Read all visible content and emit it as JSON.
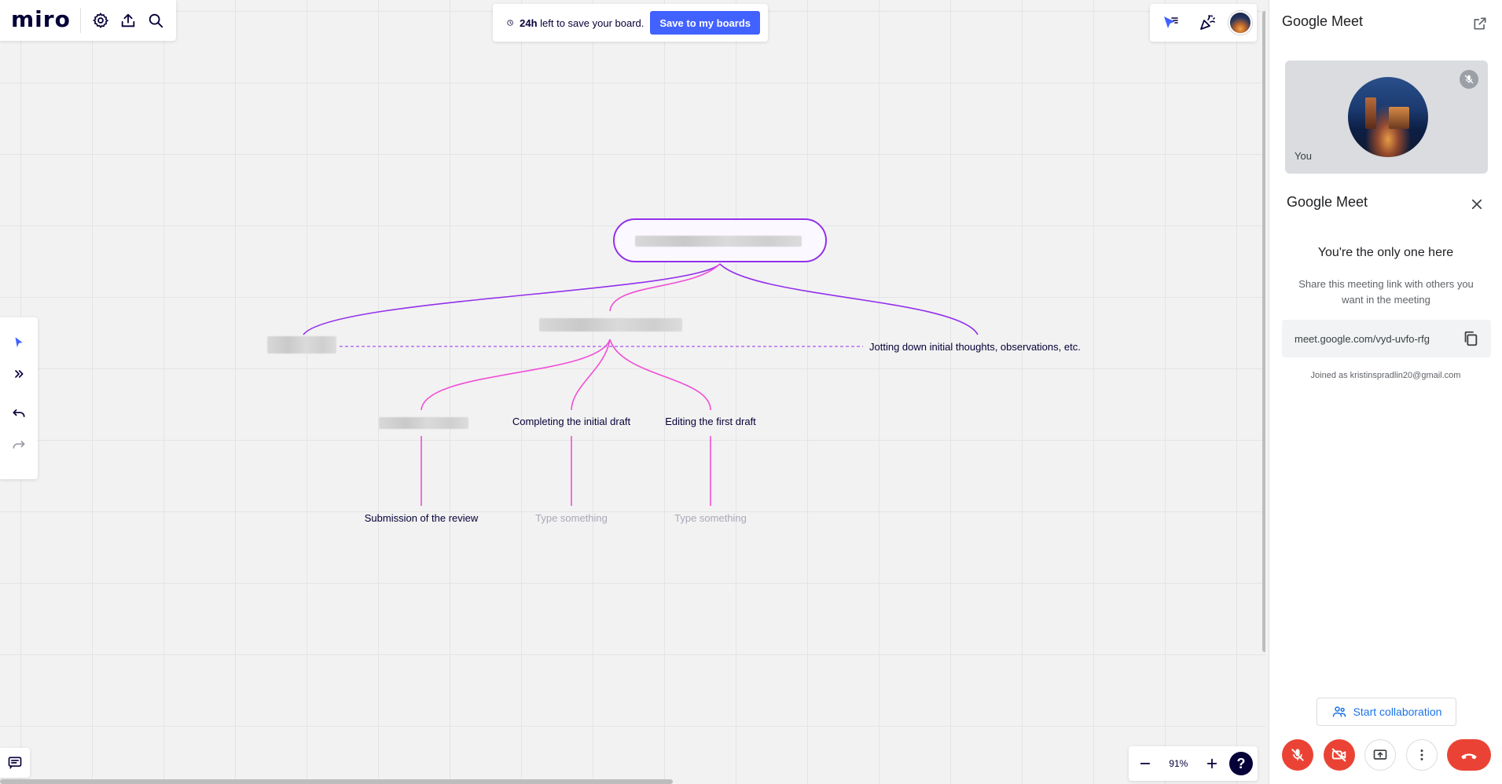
{
  "board": {
    "logo": "miro",
    "save_banner": {
      "bold": "24h",
      "text": " left to save your board.",
      "button": "Save to my boards"
    },
    "zoom": {
      "level": "91%",
      "minus": "−",
      "plus": "+",
      "help": "?"
    }
  },
  "mindmap": {
    "branch_right": "Jotting down initial thoughts, observations, etc.",
    "child_2": "Completing the initial draft",
    "child_3": "Editing the first draft",
    "leaf_1": "Submission of the review",
    "leaf_2": "Type something",
    "leaf_3": "Type something"
  },
  "meet": {
    "header": "Google Meet",
    "self_label": "You",
    "sub_header": "Google Meet",
    "alone_title": "You're the only one here",
    "share_text": "Share this meeting link with others you want in the meeting",
    "link": "meet.google.com/vyd-uvfo-rfg",
    "joined_as": "Joined as kristinspradlin20@gmail.com",
    "collab_button": "Start collaboration"
  },
  "colors": {
    "accent": "#4262ff",
    "mindmap_purple": "#9330ec",
    "mindmap_pink": "#f04ed6",
    "meet_red": "#ea4335",
    "meet_blue": "#1a73e8"
  }
}
